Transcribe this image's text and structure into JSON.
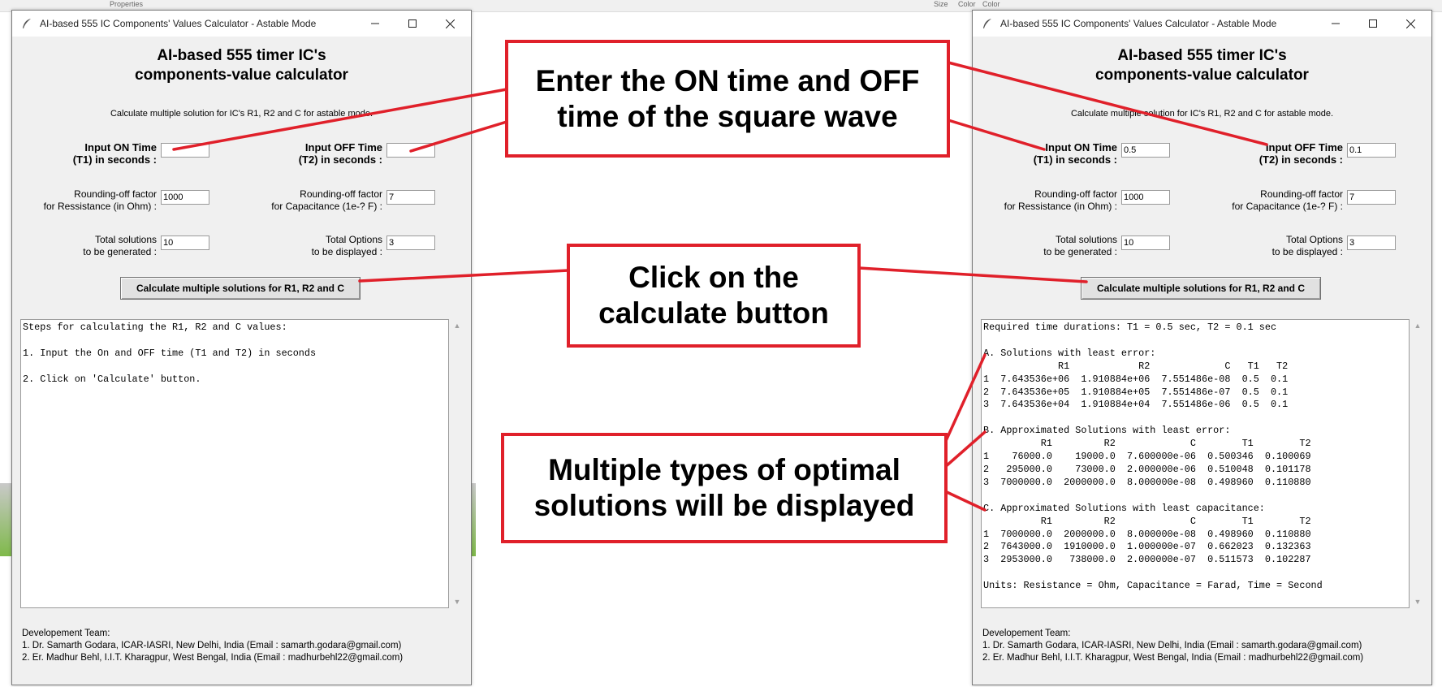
{
  "background": {
    "top_fragments": [
      "Properties",
      "Size",
      "Color",
      "Color"
    ]
  },
  "window_title": "AI-based 555 IC Components' Values Calculator - Astable Mode",
  "app_title_line1": "AI-based 555 timer IC's",
  "app_title_line2": "components-value calculator",
  "subtitle": "Calculate multiple solution for IC's R1, R2 and C for astable mode.",
  "labels": {
    "on_time_1": "Input ON Time",
    "on_time_2": "(T1) in seconds :",
    "off_time_1": "Input OFF Time",
    "off_time_2": "(T2) in seconds :",
    "round_r_1": "Rounding-off factor",
    "round_r_2": "for Ressistance (in Ohm) :",
    "round_c_1": "Rounding-off factor",
    "round_c_2": "for Capacitance (1e-? F) :",
    "total_1": "Total solutions",
    "total_2": "to be generated :",
    "options_1": "Total Options",
    "options_2": "to be displayed :"
  },
  "calc_button": "Calculate multiple solutions for R1, R2 and C",
  "footer": {
    "heading": "Developement Team:",
    "line1": "1. Dr. Samarth Godara, ICAR-IASRI, New Delhi, India (Email : samarth.godara@gmail.com)",
    "line2": "2. Er. Madhur Behl, I.I.T. Kharagpur, West Bengal, India (Email : madhurbehl22@gmail.com)"
  },
  "left_window": {
    "on_time": "",
    "off_time": "",
    "round_r": "1000",
    "round_c": "7",
    "total": "10",
    "options": "3",
    "output": "Steps for calculating the R1, R2 and C values:\n\n1. Input the On and OFF time (T1 and T2) in seconds\n\n2. Click on 'Calculate' button."
  },
  "right_window": {
    "on_time": "0.5",
    "off_time": "0.1",
    "round_r": "1000",
    "round_c": "7",
    "total": "10",
    "options": "3",
    "output": "Required time durations: T1 = 0.5 sec, T2 = 0.1 sec\n\nA. Solutions with least error:\n             R1            R2             C   T1   T2\n1  7.643536e+06  1.910884e+06  7.551486e-08  0.5  0.1\n2  7.643536e+05  1.910884e+05  7.551486e-07  0.5  0.1\n3  7.643536e+04  1.910884e+04  7.551486e-06  0.5  0.1\n\nB. Approximated Solutions with least error:\n          R1         R2             C        T1        T2\n1    76000.0    19000.0  7.600000e-06  0.500346  0.100069\n2   295000.0    73000.0  2.000000e-06  0.510048  0.101178\n3  7000000.0  2000000.0  8.000000e-08  0.498960  0.110880\n\nC. Approximated Solutions with least capacitance:\n          R1         R2             C        T1        T2\n1  7000000.0  2000000.0  8.000000e-08  0.498960  0.110880\n2  7643000.0  1910000.0  1.000000e-07  0.662023  0.132363\n3  2953000.0   738000.0  2.000000e-07  0.511573  0.102287\n\nUnits: Resistance = Ohm, Capacitance = Farad, Time = Second"
  },
  "annotations": {
    "box1": [
      "Enter  the ON time and OFF",
      "time of the square wave"
    ],
    "box2": [
      "Click on the",
      "calculate button"
    ],
    "box3": [
      "Multiple types of optimal",
      "solutions will be displayed"
    ]
  },
  "colors": {
    "annotation_red": "#e0202a",
    "window_bg": "#f0f0f0"
  }
}
